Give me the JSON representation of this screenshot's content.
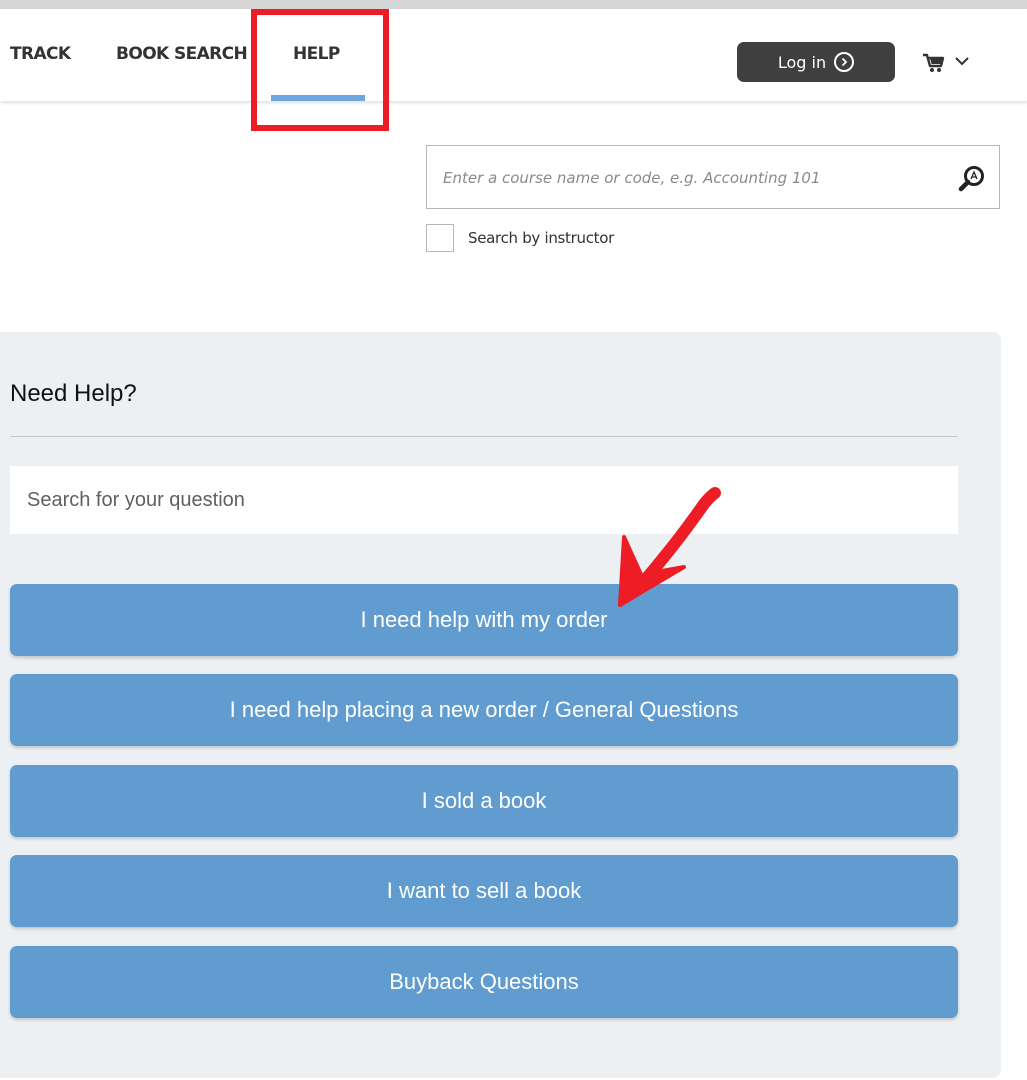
{
  "nav": {
    "items": [
      {
        "label": "TRACK"
      },
      {
        "label": "BOOK SEARCH"
      },
      {
        "label": "HELP",
        "active": true
      }
    ],
    "login_label": "Log in"
  },
  "course_search": {
    "placeholder": "Enter a course name or code, e.g. Accounting 101",
    "instructor_label": "Search by instructor",
    "instructor_checked": false
  },
  "help": {
    "title": "Need Help?",
    "search_placeholder": "Search for your question",
    "buttons": [
      {
        "label": "I need help with my order"
      },
      {
        "label": "I need help placing a new order / General Questions"
      },
      {
        "label": "I sold a book"
      },
      {
        "label": "I want to sell a book"
      },
      {
        "label": "Buyback Questions"
      }
    ]
  },
  "colors": {
    "accent_underline": "#6fa6de",
    "help_button": "#609ccf",
    "login_button": "#3f3f3f",
    "annotation_red": "#ee1c24",
    "panel_bg": "#edf0f3"
  },
  "icons": {
    "login": "chevron-circle-right-icon",
    "cart": "cart-icon",
    "cart_menu": "chevron-down-icon",
    "search": "magnifier-icon"
  }
}
